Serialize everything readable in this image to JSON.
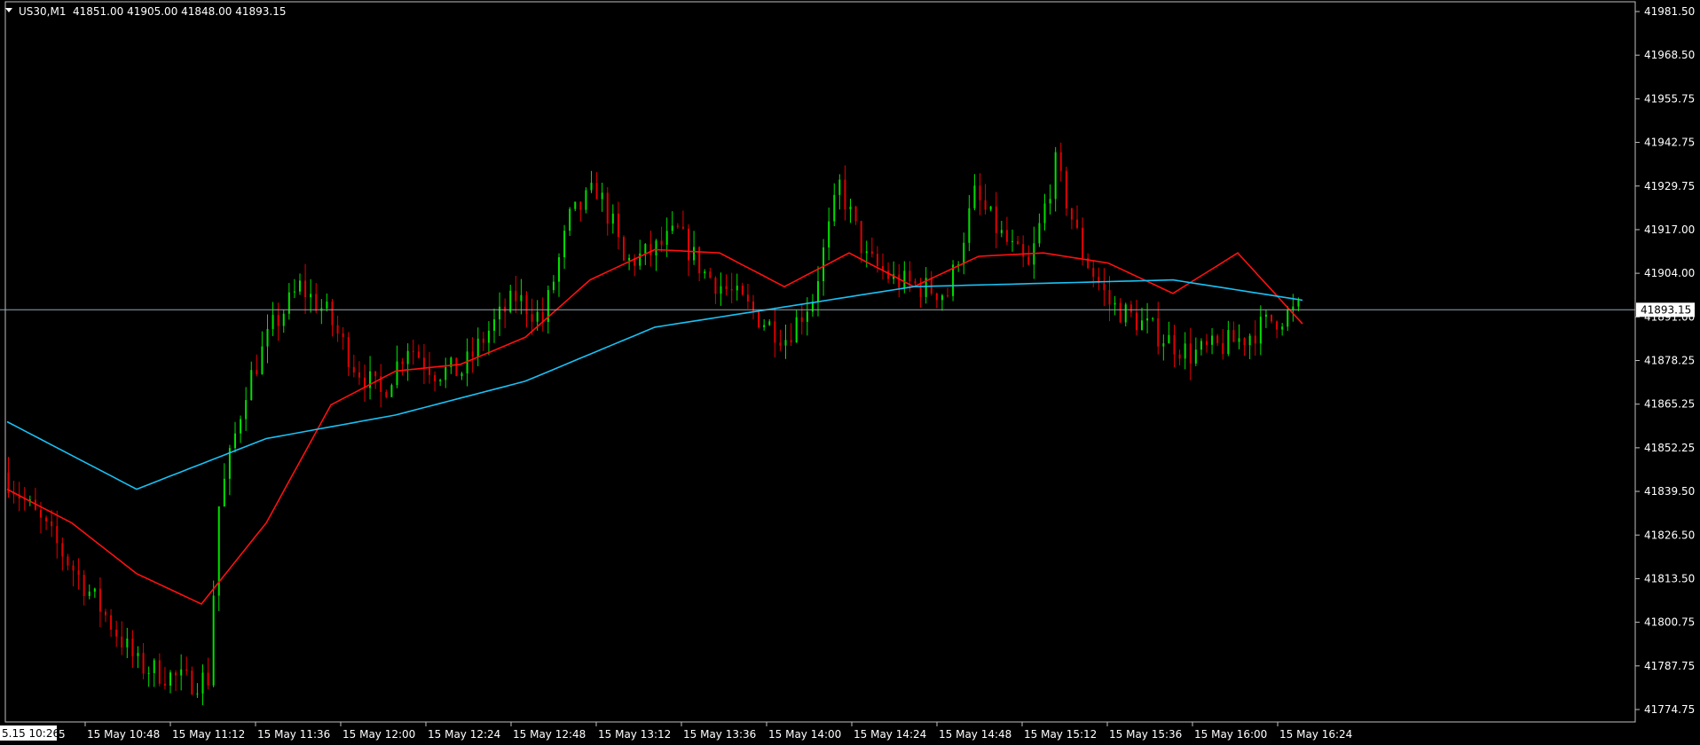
{
  "header": {
    "dropdown_icon": "triangle-down-icon",
    "symbol": "US30,M1",
    "ohlc": "41851.00 41905.00 41848.00 41893.15"
  },
  "colors": {
    "background": "#000000",
    "frame": "#c0c0c0",
    "bull": "#00e000",
    "bear": "#e00000",
    "ma_fast": "#ff1010",
    "ma_slow": "#19c2f5",
    "bid_line": "#9aa5ae",
    "text": "#ffffff"
  },
  "price_scale": {
    "ticks": [
      "41981.50",
      "41968.50",
      "41955.75",
      "41942.75",
      "41929.75",
      "41917.00",
      "41904.00",
      "41891.00",
      "41878.25",
      "41865.25",
      "41852.25",
      "41839.50",
      "41826.50",
      "41813.50",
      "41800.75",
      "41787.75",
      "41774.75"
    ],
    "current_price": "41893.15"
  },
  "time_scale": {
    "cursor_label": "5.15 10:26",
    "cursor_label_suffix": "5",
    "ticks": [
      "15 May 10:48",
      "15 May 11:12",
      "15 May 11:36",
      "15 May 12:00",
      "15 May 12:24",
      "15 May 12:48",
      "15 May 13:12",
      "15 May 13:36",
      "15 May 14:00",
      "15 May 14:24",
      "15 May 14:48",
      "15 May 15:12",
      "15 May 15:36",
      "15 May 16:00",
      "15 May 16:24"
    ]
  },
  "chart_data": {
    "type": "candlestick",
    "symbol": "US30",
    "timeframe": "M1",
    "y_axis_range": [
      41774.75,
      41981.5
    ],
    "bar_count": 240,
    "approx_close_anchors": [
      [
        0,
        41845
      ],
      [
        8,
        41828
      ],
      [
        18,
        41805
      ],
      [
        25,
        41788
      ],
      [
        34,
        41783
      ],
      [
        38,
        41784
      ],
      [
        40,
        41835
      ],
      [
        45,
        41870
      ],
      [
        50,
        41888
      ],
      [
        55,
        41900
      ],
      [
        60,
        41892
      ],
      [
        65,
        41877
      ],
      [
        70,
        41868
      ],
      [
        75,
        41883
      ],
      [
        80,
        41875
      ],
      [
        85,
        41875
      ],
      [
        90,
        41887
      ],
      [
        95,
        41897
      ],
      [
        100,
        41890
      ],
      [
        105,
        41920
      ],
      [
        110,
        41929
      ],
      [
        113,
        41918
      ],
      [
        115,
        41907
      ],
      [
        120,
        41910
      ],
      [
        125,
        41916
      ],
      [
        130,
        41904
      ],
      [
        135,
        41898
      ],
      [
        140,
        41891
      ],
      [
        145,
        41885
      ],
      [
        150,
        41897
      ],
      [
        155,
        41930
      ],
      [
        160,
        41908
      ],
      [
        165,
        41902
      ],
      [
        170,
        41900
      ],
      [
        175,
        41898
      ],
      [
        180,
        41927
      ],
      [
        185,
        41915
      ],
      [
        190,
        41905
      ],
      [
        195,
        41936
      ],
      [
        200,
        41910
      ],
      [
        205,
        41895
      ],
      [
        210,
        41890
      ],
      [
        215,
        41885
      ],
      [
        220,
        41880
      ],
      [
        225,
        41882
      ],
      [
        230,
        41885
      ],
      [
        235,
        41890
      ],
      [
        240,
        41893
      ]
    ],
    "series": [
      {
        "name": "",
        "kind": "moving-average",
        "color_key": "ma_fast",
        "points": [
          [
            0,
            41840
          ],
          [
            12,
            41830
          ],
          [
            24,
            41815
          ],
          [
            36,
            41806
          ],
          [
            48,
            41830
          ],
          [
            60,
            41865
          ],
          [
            72,
            41875
          ],
          [
            84,
            41877
          ],
          [
            96,
            41885
          ],
          [
            108,
            41902
          ],
          [
            120,
            41911
          ],
          [
            132,
            41910
          ],
          [
            144,
            41900
          ],
          [
            156,
            41910
          ],
          [
            168,
            41900
          ],
          [
            180,
            41909
          ],
          [
            192,
            41910
          ],
          [
            204,
            41907
          ],
          [
            216,
            41898
          ],
          [
            228,
            41910
          ],
          [
            240,
            41889
          ]
        ]
      },
      {
        "name": "",
        "kind": "moving-average",
        "color_key": "ma_slow",
        "points": [
          [
            0,
            41860
          ],
          [
            24,
            41840
          ],
          [
            48,
            41855
          ],
          [
            72,
            41862
          ],
          [
            96,
            41872
          ],
          [
            120,
            41888
          ],
          [
            144,
            41894
          ],
          [
            168,
            41900
          ],
          [
            192,
            41901
          ],
          [
            216,
            41902
          ],
          [
            240,
            41896
          ]
        ]
      }
    ]
  }
}
